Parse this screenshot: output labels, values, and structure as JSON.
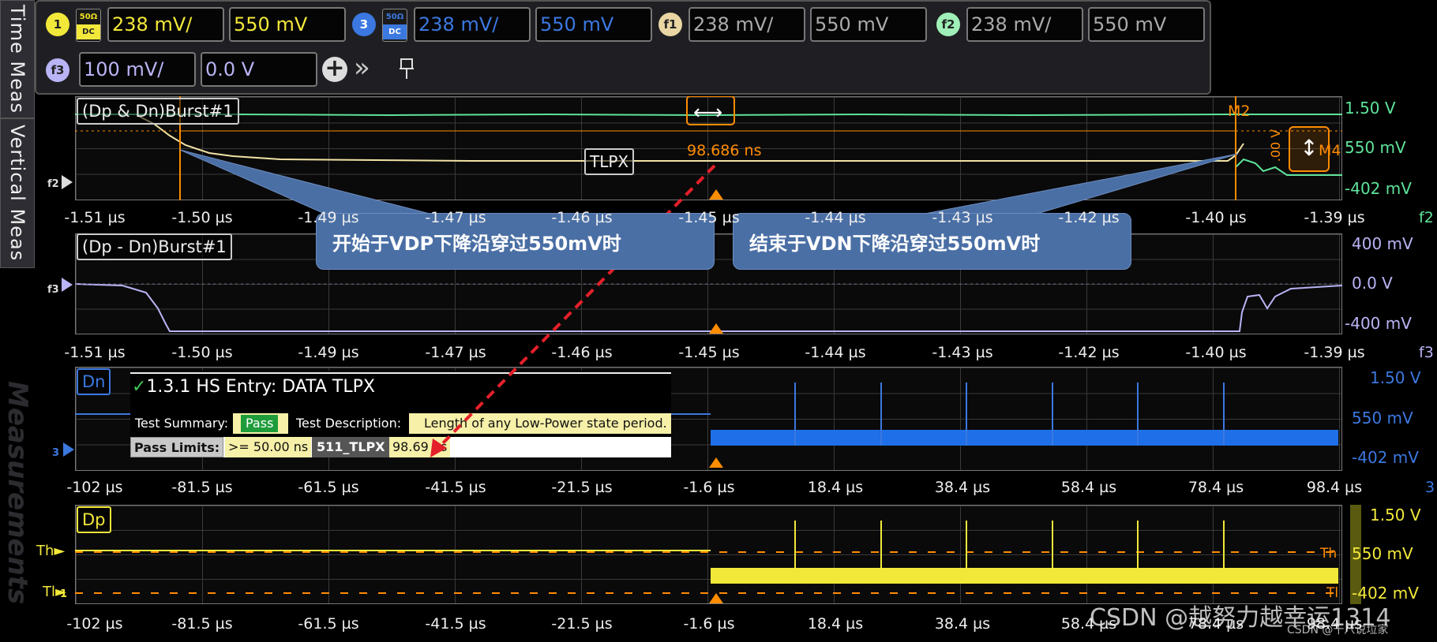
{
  "sidebar": {
    "tab_time_meas": "Time Meas",
    "tab_vertical_meas": "Vertical Meas",
    "watermark": "Measurements"
  },
  "toolbar": {
    "ch1": {
      "chip": "1",
      "coupling_top": "50Ω",
      "coupling_bottom": "DC",
      "scale": "238 mV/",
      "offset": "550 mV",
      "color": "#f2e83a"
    },
    "ch3": {
      "chip": "3",
      "coupling_top": "50Ω",
      "coupling_bottom": "DC",
      "scale": "238 mV/",
      "offset": "550 mV",
      "color": "#3b78e0"
    },
    "f1": {
      "chip": "f1",
      "scale": "238 mV/",
      "offset": "550 mV",
      "color": "#e9d6a3"
    },
    "f2": {
      "chip": "f2",
      "scale": "238 mV/",
      "offset": "550 mV",
      "color": "#9ff0b8"
    },
    "f3": {
      "chip": "f3",
      "scale": "100 mV/",
      "offset": "0.0 V",
      "color": "#b9b4f5"
    },
    "add_icon": "plus-circle-icon",
    "expand_icon": "double-chevron-right-icon",
    "pin_icon": "pin-icon"
  },
  "panel_f2": {
    "label": "(Dp & Dn)Burst#1",
    "channel_marker": "f2",
    "x_ticks": [
      "-1.51 µs",
      "-1.50 µs",
      "-1.49 µs",
      "-1.47 µs",
      "-1.46 µs",
      "-1.45 µs",
      "-1.44 µs",
      "-1.43 µs",
      "-1.42 µs",
      "-1.40 µs",
      "-1.39 µs"
    ],
    "y_labels": [
      "1.50 V",
      "550 mV",
      "-402 mV"
    ],
    "measurement": "98.686 ns",
    "marker_m2": "M2",
    "marker_m4": "M4",
    "delta_label": ".00 V",
    "tlpx_label": "TLPX"
  },
  "panel_f3": {
    "label": "(Dp - Dn)Burst#1",
    "channel_marker": "f3",
    "x_ticks": [
      "-1.51 µs",
      "-1.50 µs",
      "-1.49 µs",
      "-1.47 µs",
      "-1.46 µs",
      "-1.45 µs",
      "-1.44 µs",
      "-1.43 µs",
      "-1.42 µs",
      "-1.40 µs",
      "-1.39 µs"
    ],
    "y_labels": [
      "400 mV",
      "0.0 V",
      "-400 mV"
    ]
  },
  "panel_dn": {
    "label": "Dn",
    "channel_marker": "3",
    "x_ticks": [
      "-102 µs",
      "-81.5 µs",
      "-61.5 µs",
      "-41.5 µs",
      "-21.5 µs",
      "-1.6 µs",
      "18.4 µs",
      "38.4 µs",
      "58.4 µs",
      "78.4 µs",
      "98.4 µs"
    ],
    "y_labels": [
      "1.50 V",
      "550 mV",
      "-402 mV"
    ]
  },
  "panel_dp": {
    "label": "Dp",
    "channel_marker": "1",
    "x_ticks": [
      "-102 µs",
      "-81.5 µs",
      "-61.5 µs",
      "-41.5 µs",
      "-21.5 µs",
      "-1.6 µs",
      "18.4 µs",
      "38.4 µs",
      "58.4 µs",
      "78.4 µs",
      "98.4 µs"
    ],
    "y_labels": [
      "1.50 V",
      "550 mV",
      "-402 mV"
    ],
    "th_label": "Th",
    "tl_label": "Tl"
  },
  "callouts": {
    "start": "开始于VDP下降沿穿过550mV时",
    "end": "结束于VDN下降沿穿过550mV时"
  },
  "test_summary": {
    "title": "1.3.1 HS Entry: DATA TLPX",
    "summary_label": "Test Summary:",
    "result": "Pass",
    "description_label": "Test Description:",
    "description": "Length of any Low-Power state period.",
    "pass_limits_label": "Pass Limits:",
    "pass_limits_value": ">= 50.00 ns",
    "measure_name": "511_TLPX",
    "measure_value": "98.69 ns"
  },
  "watermark": {
    "main": "CSDN @越努力越幸运1314",
    "sub": "CSDN @十八说垃家"
  }
}
